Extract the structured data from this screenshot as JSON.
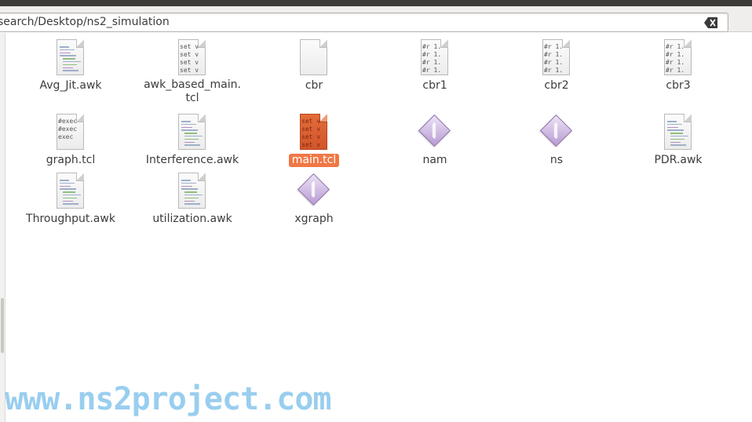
{
  "location": {
    "path": "search/Desktop/ns2_simulation"
  },
  "files": [
    {
      "name": "Avg_Jit.awk",
      "type": "awk-doc",
      "icon": "text-document-icon"
    },
    {
      "name": "awk_based_main.\ntcl",
      "type": "script",
      "icon": "script-document-icon",
      "preview": "set v\nset v\nset v\nset v"
    },
    {
      "name": "cbr",
      "type": "blank",
      "icon": "blank-document-icon"
    },
    {
      "name": "cbr1",
      "type": "data",
      "icon": "data-document-icon",
      "preview": "#r 1.\n#r 1.\n#r 1.\n#r 1."
    },
    {
      "name": "cbr2",
      "type": "data",
      "icon": "data-document-icon",
      "preview": "#r 1.\n#r 1.\n#r 1.\n#r 1."
    },
    {
      "name": "cbr3",
      "type": "data",
      "icon": "data-document-icon",
      "preview": "#r 1.\n#r 1.\n#r 1.\n#r 1."
    },
    {
      "name": "graph.tcl",
      "type": "exec",
      "icon": "script-document-icon",
      "preview": "#exec\n#exec\nexec"
    },
    {
      "name": "Interference.awk",
      "type": "awk-doc",
      "icon": "text-document-icon"
    },
    {
      "name": "main.tcl",
      "type": "selected-script",
      "icon": "script-document-icon",
      "preview": "set v\nset v\nset v\nset v",
      "selected": true
    },
    {
      "name": "nam",
      "type": "exe",
      "icon": "executable-icon"
    },
    {
      "name": "ns",
      "type": "exe",
      "icon": "executable-icon"
    },
    {
      "name": "PDR.awk",
      "type": "awk-doc",
      "icon": "text-document-icon"
    },
    {
      "name": "Throughput.awk",
      "type": "awk-doc",
      "icon": "text-document-icon"
    },
    {
      "name": "utilization.awk",
      "type": "awk-doc",
      "icon": "text-document-icon"
    },
    {
      "name": "xgraph",
      "type": "exe",
      "icon": "executable-icon"
    }
  ],
  "watermark": "www.ns2project.com",
  "colors": {
    "selection": "#f07746",
    "watermark": "#8fc9ee",
    "frame": "#3c3b37"
  }
}
